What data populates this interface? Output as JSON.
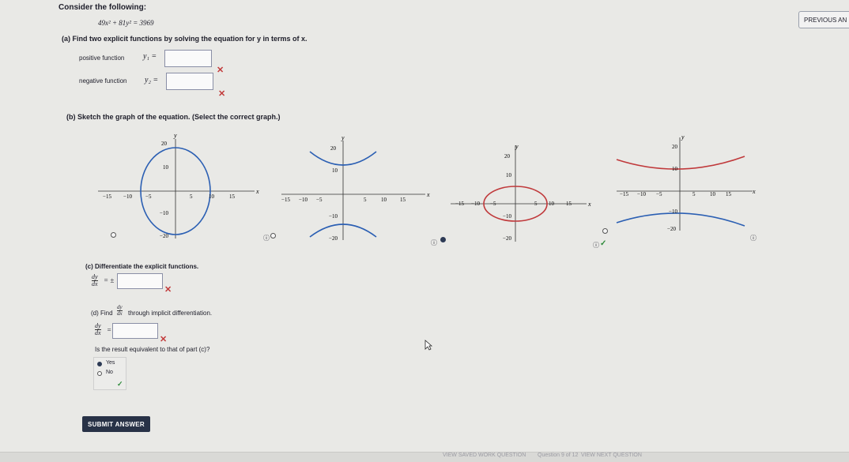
{
  "header": {
    "intro": "Consider the following:",
    "equation": "49x² + 81y² = 3969",
    "previous_button": "PREVIOUS AN"
  },
  "part_a": {
    "prompt": "(a)  Find two explicit functions by solving the equation for y in terms of x.",
    "positive_label": "positive function",
    "negative_label": "negative function",
    "y1_label": "y₁ =",
    "y2_label": "y₂ =",
    "y1_value": "",
    "y2_value": "",
    "incorrect_mark": "✕"
  },
  "part_b": {
    "prompt": "(b)  Sketch the graph of the equation. (Select the correct graph.)",
    "correct_mark": "✓",
    "info_icon": "ⓘ",
    "graphs": [
      {
        "type": "ellipse",
        "semi_x": 10,
        "semi_y": 20,
        "selected": false,
        "axis_x": "x",
        "axis_y": "y",
        "xticks": [
          "−15",
          "−10",
          "−5",
          "5",
          "10",
          "15"
        ],
        "yticks": [
          "20",
          "10",
          "−10",
          "−20"
        ]
      },
      {
        "type": "hyperbola",
        "selected": false,
        "axis_x": "x",
        "axis_y": "y",
        "xticks": [
          "−15",
          "−10",
          "−5",
          "5",
          "10",
          "15"
        ],
        "yticks": [
          "20",
          "10",
          "−10",
          "−20"
        ]
      },
      {
        "type": "ellipse",
        "semi_x": 9,
        "semi_y": 7,
        "selected": true,
        "axis_x": "x",
        "axis_y": "y",
        "xticks": [
          "−15",
          "−10",
          "−5",
          "5",
          "10",
          "15"
        ],
        "yticks": [
          "20",
          "10",
          "−10",
          "−20"
        ]
      },
      {
        "type": "hyperbola",
        "selected": false,
        "axis_x": "x",
        "axis_y": "y",
        "xticks": [
          "−15",
          "−10",
          "−5",
          "5",
          "10",
          "15"
        ],
        "yticks": [
          "20",
          "10",
          "−10",
          "−20"
        ]
      }
    ]
  },
  "part_c": {
    "prompt": "(c)  Differentiate the explicit functions.",
    "lhs_num": "dy",
    "lhs_den": "dx",
    "eq": "= ±",
    "value": ""
  },
  "part_d": {
    "prompt_prefix": "(d)  Find",
    "prompt_suffix": "through implicit differentiation.",
    "frac_num": "dy",
    "frac_den": "dx",
    "eq": "=",
    "value": "",
    "question": "Is the result equivalent to that of part (c)?",
    "options": [
      {
        "label": "Yes",
        "selected": true
      },
      {
        "label": "No",
        "selected": false
      }
    ]
  },
  "submit": "SUBMIT ANSWER",
  "footer": {
    "left": "VIEW SAVED WORK QUESTION",
    "center": "Question 9 of 12",
    "right": "VIEW NEXT QUESTION"
  }
}
